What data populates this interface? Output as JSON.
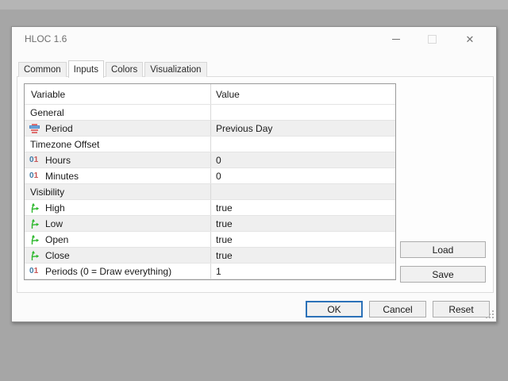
{
  "window": {
    "title": "HLOC 1.6"
  },
  "titlebar": {
    "minimize_icon": "minimize",
    "maximize_icon": "maximize",
    "close_icon": "✕"
  },
  "tabs": [
    {
      "label": "Common",
      "active": false
    },
    {
      "label": "Inputs",
      "active": true
    },
    {
      "label": "Colors",
      "active": false
    },
    {
      "label": "Visualization",
      "active": false
    }
  ],
  "table": {
    "columns": [
      "Variable",
      "Value"
    ],
    "rows": [
      {
        "kind": "group",
        "icon": "none",
        "label": "General",
        "value": "",
        "shaded": false
      },
      {
        "kind": "param",
        "icon": "enum",
        "label": "Period",
        "value": "Previous Day",
        "shaded": true
      },
      {
        "kind": "group",
        "icon": "none",
        "label": "Timezone Offset",
        "value": "",
        "shaded": false
      },
      {
        "kind": "param",
        "icon": "int",
        "label": "Hours",
        "value": "0",
        "shaded": true
      },
      {
        "kind": "param",
        "icon": "int",
        "label": "Minutes",
        "value": "0",
        "shaded": false
      },
      {
        "kind": "group",
        "icon": "none",
        "label": "Visibility",
        "value": "",
        "shaded": true
      },
      {
        "kind": "param",
        "icon": "bool",
        "label": "High",
        "value": "true",
        "shaded": false
      },
      {
        "kind": "param",
        "icon": "bool",
        "label": "Low",
        "value": "true",
        "shaded": true
      },
      {
        "kind": "param",
        "icon": "bool",
        "label": "Open",
        "value": "true",
        "shaded": false
      },
      {
        "kind": "param",
        "icon": "bool",
        "label": "Close",
        "value": "true",
        "shaded": true
      },
      {
        "kind": "param",
        "icon": "int",
        "label": "Periods (0 = Draw everything)",
        "value": "1",
        "shaded": false
      }
    ]
  },
  "buttons": {
    "load": "Load",
    "save": "Save",
    "ok": "OK",
    "cancel": "Cancel",
    "reset": "Reset"
  },
  "colors": {
    "accent_ok_border": "#2b71b8",
    "row_shaded": "#efefef",
    "bool_icon_green": "#2eb82e",
    "int_icon_zero": "#3f7ba6",
    "int_icon_one": "#c65555",
    "enum_icon_red": "#e07070",
    "enum_icon_blue": "#6fa8dc",
    "desktop_background": "#a6a6a6"
  }
}
